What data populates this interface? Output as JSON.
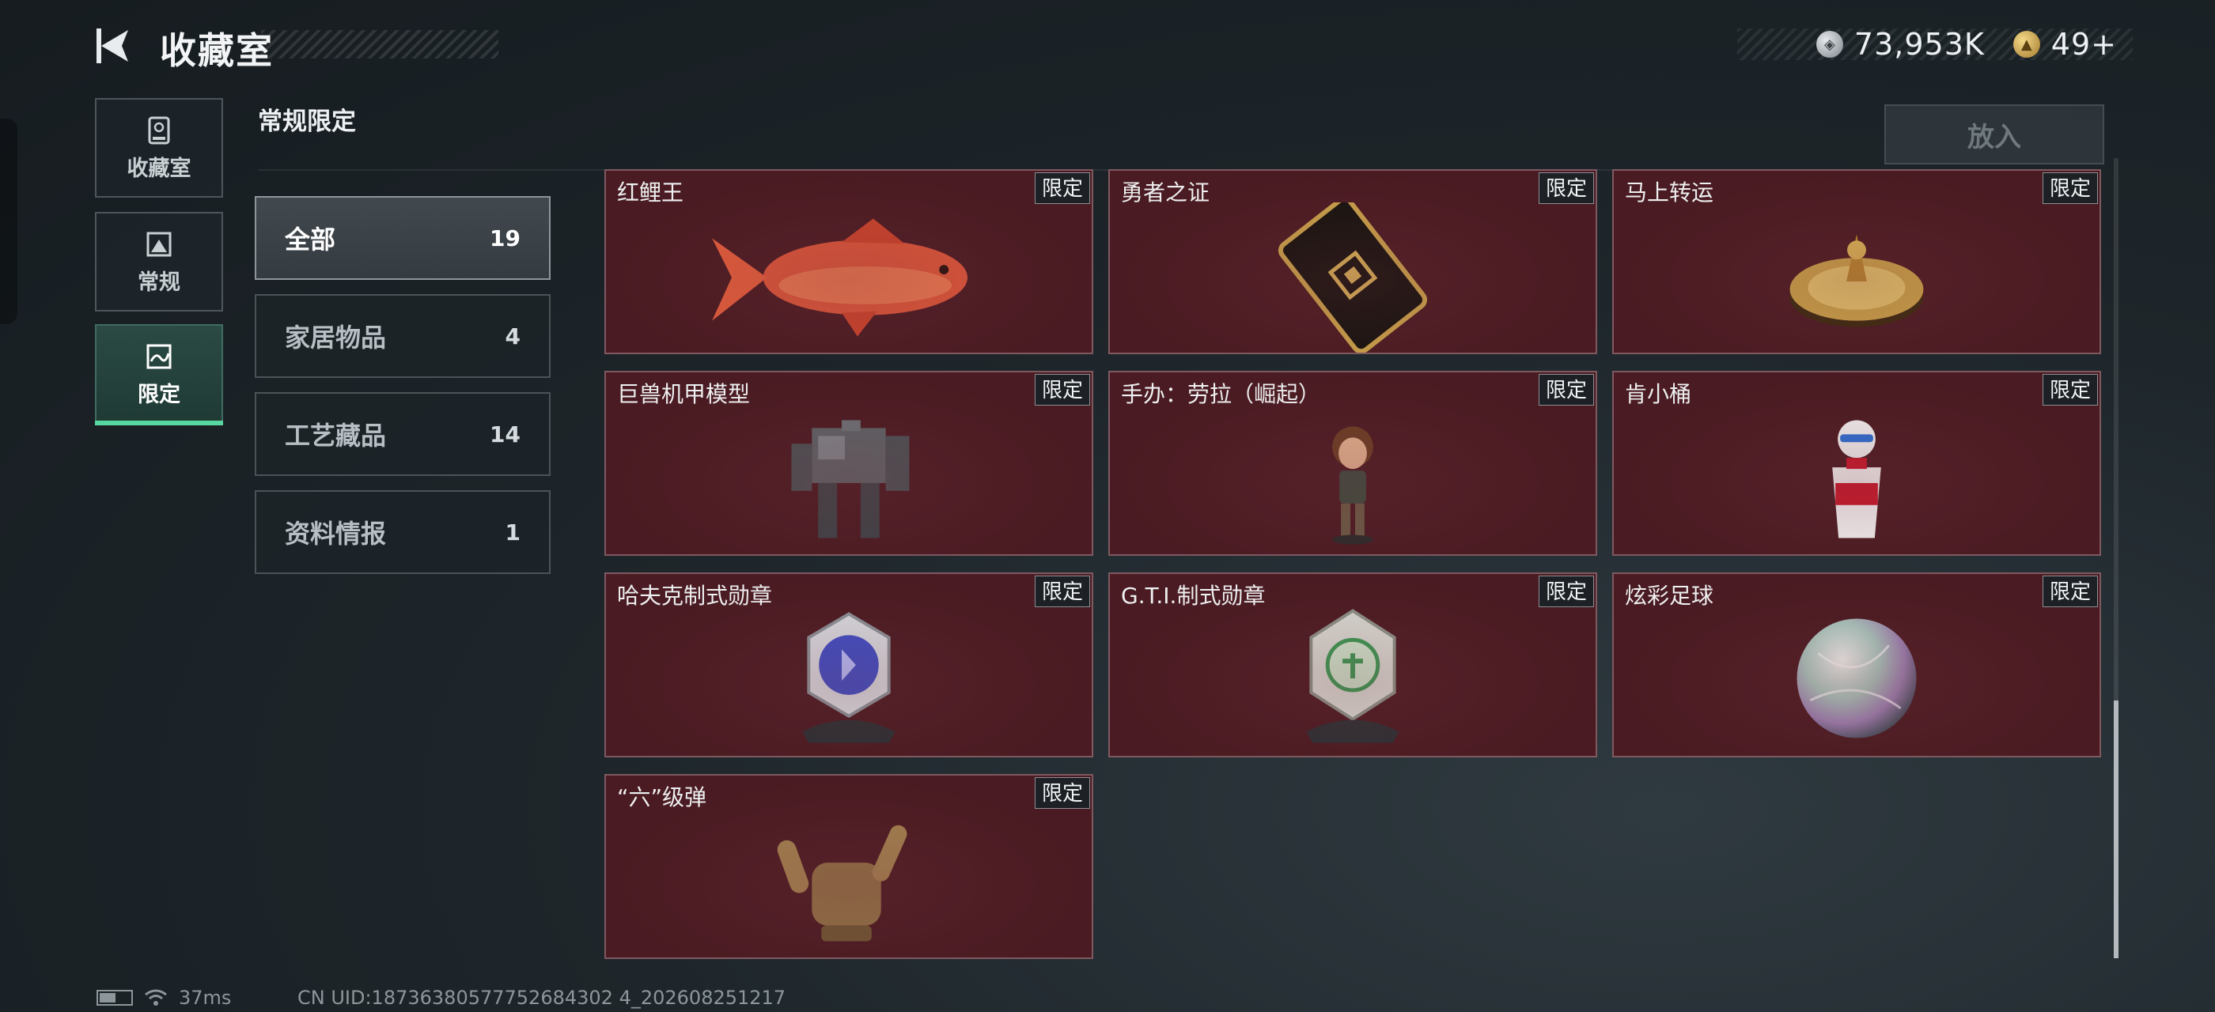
{
  "header": {
    "title": "收藏室",
    "currencies": [
      {
        "icon": "silver-coin-icon",
        "value": "73,953K"
      },
      {
        "icon": "gold-coin-icon",
        "value": "49+"
      }
    ]
  },
  "rail": {
    "items": [
      {
        "label": "收藏室",
        "icon": "trophy-icon",
        "active": false
      },
      {
        "label": "常规",
        "icon": "image-frame-icon",
        "active": false
      },
      {
        "label": "限定",
        "icon": "limited-frame-icon",
        "active": true
      }
    ]
  },
  "subcategory": {
    "heading": "常规限定",
    "items": [
      {
        "name": "全部",
        "count": "19",
        "active": true
      },
      {
        "name": "家居物品",
        "count": "4",
        "active": false
      },
      {
        "name": "工艺藏品",
        "count": "14",
        "active": false
      },
      {
        "name": "资料情报",
        "count": "1",
        "active": false
      }
    ]
  },
  "place_button": "放入",
  "cards": [
    {
      "name": "红鲤王",
      "tag": "限定",
      "art": "carp-fish"
    },
    {
      "name": "勇者之证",
      "tag": "限定",
      "art": "badge-card"
    },
    {
      "name": "马上转运",
      "tag": "限定",
      "art": "gold-spinner"
    },
    {
      "name": "巨兽机甲模型",
      "tag": "限定",
      "art": "mech-model"
    },
    {
      "name": "手办：劳拉（崛起）",
      "tag": "限定",
      "art": "figure-lara"
    },
    {
      "name": "肯小桶",
      "tag": "限定",
      "art": "kfc-bucket"
    },
    {
      "name": "哈夫克制式勋章",
      "tag": "限定",
      "art": "medal-blue"
    },
    {
      "name": "G.T.I.制式勋章",
      "tag": "限定",
      "art": "medal-green"
    },
    {
      "name": "炫彩足球",
      "tag": "限定",
      "art": "iridescent-ball"
    },
    {
      "name": "“六”级弹",
      "tag": "限定",
      "art": "hand-sign"
    }
  ],
  "footer": {
    "ping": "37ms",
    "uid": "CN UID:18736380577752684302 4_202608251217"
  },
  "colors": {
    "card_bg": "#4a1b22",
    "accent_green": "#58d8a0",
    "tag_bg": "#1d2125"
  }
}
